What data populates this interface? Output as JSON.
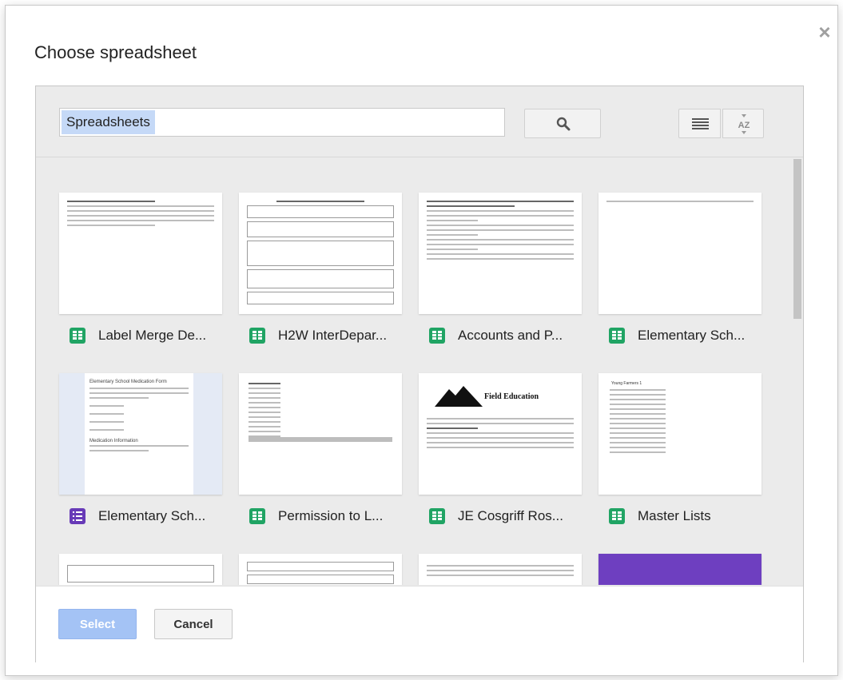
{
  "dialog": {
    "title": "Choose spreadsheet",
    "close_label": "×"
  },
  "search": {
    "query": "Spreadsheets",
    "sort_label": "AZ"
  },
  "files": [
    {
      "name": "Label Merge De...",
      "type": "spreadsheet"
    },
    {
      "name": "H2W InterDepar...",
      "type": "spreadsheet"
    },
    {
      "name": "Accounts and P...",
      "type": "spreadsheet"
    },
    {
      "name": "Elementary Sch...",
      "type": "spreadsheet"
    },
    {
      "name": "Elementary Sch...",
      "type": "form"
    },
    {
      "name": "Permission to L...",
      "type": "spreadsheet"
    },
    {
      "name": "JE Cosgriff Ros...",
      "type": "spreadsheet"
    },
    {
      "name": "Master Lists",
      "type": "spreadsheet"
    }
  ],
  "thumbnails": {
    "field_education": "Field Education",
    "medication_form": "Elementary School Medication Form",
    "medication_info": "Medication Information",
    "young_farmers": "Young Farmers 1"
  },
  "colors": {
    "sheet_green": "#20a464",
    "form_purple": "#673ab7",
    "select_blue": "#a4c3f5"
  },
  "footer": {
    "select_label": "Select",
    "cancel_label": "Cancel"
  }
}
